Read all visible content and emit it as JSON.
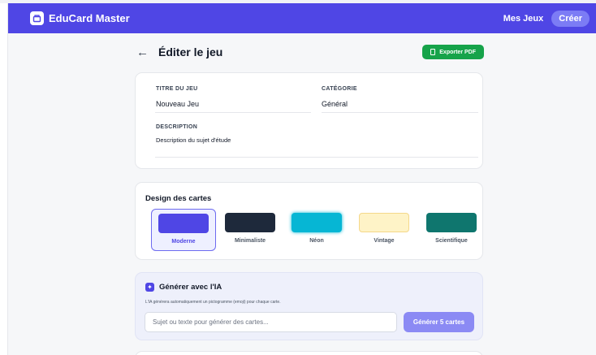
{
  "navbar": {
    "app_name": "EduCard Master",
    "logo_icon": "card-stack-icon",
    "links": {
      "my_games": "Mes Jeux",
      "create": "Créer"
    },
    "color": "#4f46e5"
  },
  "header": {
    "back_icon": "arrow-left-icon",
    "title": "Éditer le jeu",
    "export_label": "Exporter PDF",
    "export_color": "#16a34a"
  },
  "form": {
    "title_label": "TITRE DU JEU",
    "title_value": "Nouveau Jeu",
    "category_label": "CATÉGORIE",
    "category_value": "Général",
    "description_label": "DESCRIPTION",
    "description_value": "Description du sujet d'étude"
  },
  "design": {
    "title": "Design des cartes",
    "selected": "Moderne",
    "options": [
      {
        "label": "Moderne",
        "color": "#4f46e5"
      },
      {
        "label": "Minimaliste",
        "color": "#1e293b"
      },
      {
        "label": "Néon",
        "color": "#06b6d4"
      },
      {
        "label": "Vintage",
        "color": "#fef3c7"
      },
      {
        "label": "Scientifique",
        "color": "#0f766e"
      }
    ]
  },
  "ai": {
    "icon": "sparkle-icon",
    "title": "Générer avec l'IA",
    "description": "L'IA générera automatiquement un pictogramme (emoji) pour chaque carte.",
    "input_placeholder": "Sujet ou texte pour générer des cartes...",
    "button_label": "Générer 5 cartes"
  }
}
